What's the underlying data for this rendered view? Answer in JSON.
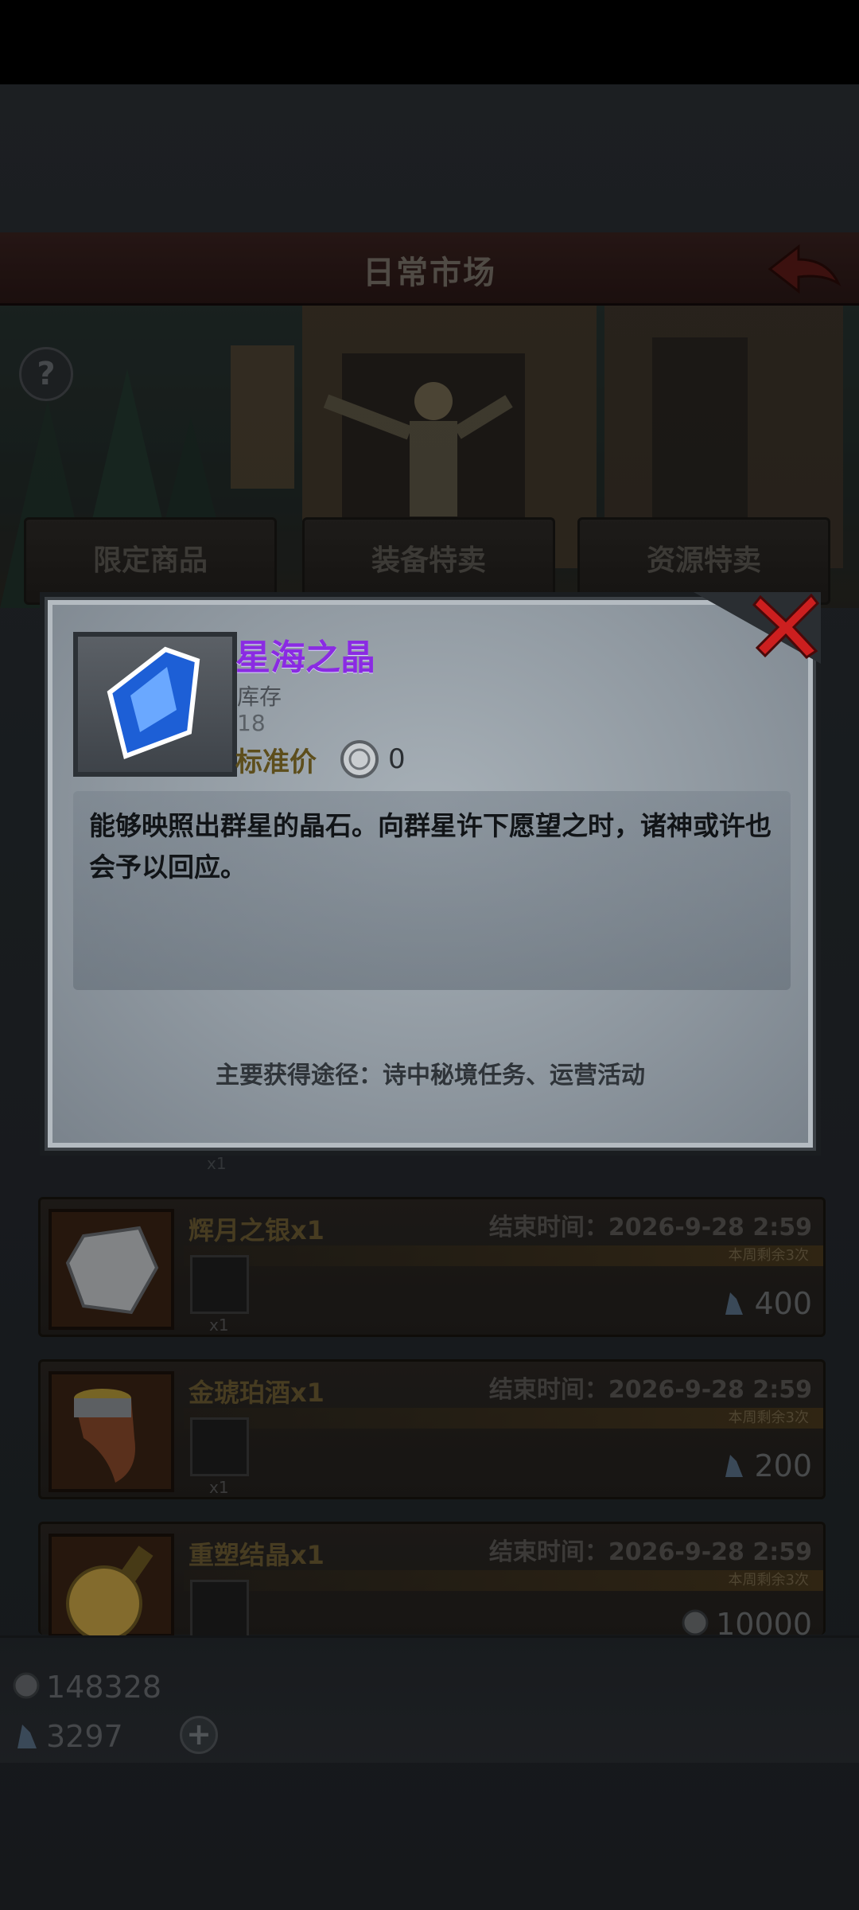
{
  "header": {
    "title": "日常市场"
  },
  "tabs": [
    {
      "label": "限定商品"
    },
    {
      "label": "装备特卖"
    },
    {
      "label": "资源特卖"
    }
  ],
  "shop_rows": [
    {
      "name": "辉月之银x1",
      "end_label": "结束时间：2026-9-28 2:59",
      "weekly": "本周剩余3次",
      "qty": "x1",
      "price": "400",
      "currency": "crystal-icon"
    },
    {
      "name": "金琥珀酒x1",
      "end_label": "结束时间：2026-9-28 2:59",
      "weekly": "本周剩余3次",
      "qty": "x1",
      "price": "200",
      "currency": "crystal-icon"
    },
    {
      "name": "重塑结晶x1",
      "end_label": "结束时间：2026-9-28 2:59",
      "weekly": "本周剩余3次",
      "qty": "",
      "price": "10000",
      "currency": "coin-icon"
    }
  ],
  "partial_row_qty": "x1",
  "resources": {
    "coins": "148328",
    "crystals": "3297"
  },
  "modal": {
    "item_name": "星海之晶",
    "stock_label": "库存",
    "stock_value": "18",
    "price_label": "标准价",
    "price_value": "0",
    "description": "能够映照出群星的晶石。向群星许下愿望之时，诸神或许也会予以回应。",
    "source": "主要获得途径：诗中秘境任务、运营活动"
  },
  "colors": {
    "item_name": "#8a2be2",
    "title_bar": "#3a2220",
    "close_red": "#cc1f1f"
  }
}
